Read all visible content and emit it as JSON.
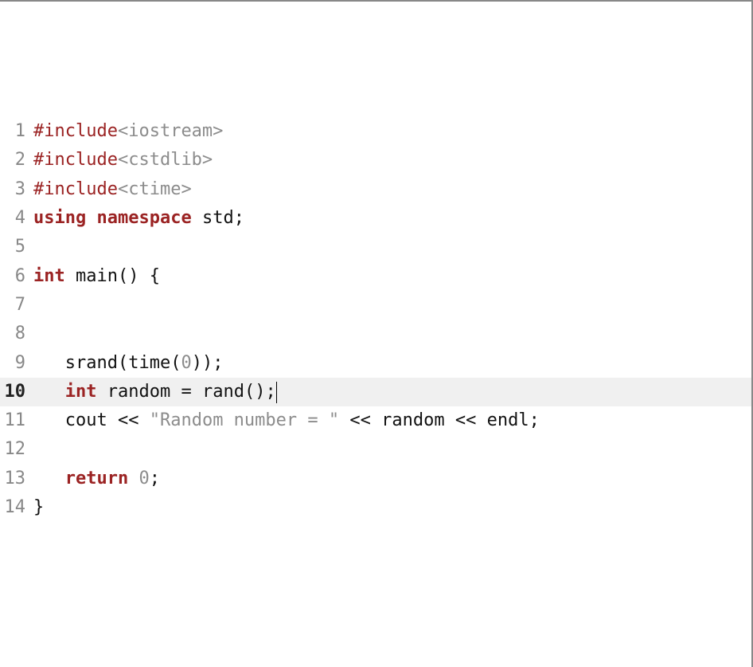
{
  "editor": {
    "highlighted_line": 10,
    "lines": [
      {
        "n": 1,
        "bold": false,
        "tokens": [
          {
            "cls": "preproc",
            "t": "#include"
          },
          {
            "cls": "anglebr",
            "t": "<iostream>"
          }
        ]
      },
      {
        "n": 2,
        "bold": false,
        "tokens": [
          {
            "cls": "preproc",
            "t": "#include"
          },
          {
            "cls": "anglebr",
            "t": "<cstdlib>"
          }
        ]
      },
      {
        "n": 3,
        "bold": false,
        "tokens": [
          {
            "cls": "preproc",
            "t": "#include"
          },
          {
            "cls": "anglebr",
            "t": "<ctime>"
          }
        ]
      },
      {
        "n": 4,
        "bold": false,
        "tokens": [
          {
            "cls": "keyword",
            "t": "using"
          },
          {
            "cls": "ident",
            "t": " "
          },
          {
            "cls": "keyword",
            "t": "namespace"
          },
          {
            "cls": "ident",
            "t": " std"
          },
          {
            "cls": "punct",
            "t": ";"
          }
        ]
      },
      {
        "n": 5,
        "bold": false,
        "tokens": []
      },
      {
        "n": 6,
        "bold": false,
        "tokens": [
          {
            "cls": "type",
            "t": "int"
          },
          {
            "cls": "ident",
            "t": " main"
          },
          {
            "cls": "punct",
            "t": "() {"
          }
        ]
      },
      {
        "n": 7,
        "bold": false,
        "tokens": []
      },
      {
        "n": 8,
        "bold": false,
        "tokens": []
      },
      {
        "n": 9,
        "bold": false,
        "tokens": [
          {
            "cls": "ident",
            "t": "   srand"
          },
          {
            "cls": "punct",
            "t": "("
          },
          {
            "cls": "ident",
            "t": "time"
          },
          {
            "cls": "punct",
            "t": "("
          },
          {
            "cls": "number",
            "t": "0"
          },
          {
            "cls": "punct",
            "t": "));"
          }
        ]
      },
      {
        "n": 10,
        "bold": true,
        "tokens": [
          {
            "cls": "ident",
            "t": "   "
          },
          {
            "cls": "type",
            "t": "int"
          },
          {
            "cls": "ident",
            "t": " random "
          },
          {
            "cls": "punct",
            "t": "="
          },
          {
            "cls": "ident",
            "t": " rand"
          },
          {
            "cls": "punct",
            "t": "();"
          }
        ],
        "cursor_after": true
      },
      {
        "n": 11,
        "bold": false,
        "tokens": [
          {
            "cls": "ident",
            "t": "   cout "
          },
          {
            "cls": "punct",
            "t": "<<"
          },
          {
            "cls": "ident",
            "t": " "
          },
          {
            "cls": "string",
            "t": "\"Random number = \""
          },
          {
            "cls": "ident",
            "t": " "
          },
          {
            "cls": "punct",
            "t": "<<"
          },
          {
            "cls": "ident",
            "t": " random "
          },
          {
            "cls": "punct",
            "t": "<<"
          },
          {
            "cls": "ident",
            "t": " endl"
          },
          {
            "cls": "punct",
            "t": ";"
          }
        ]
      },
      {
        "n": 12,
        "bold": false,
        "tokens": []
      },
      {
        "n": 13,
        "bold": false,
        "tokens": [
          {
            "cls": "ident",
            "t": "   "
          },
          {
            "cls": "keyword",
            "t": "return"
          },
          {
            "cls": "ident",
            "t": " "
          },
          {
            "cls": "number",
            "t": "0"
          },
          {
            "cls": "punct",
            "t": ";"
          }
        ]
      },
      {
        "n": 14,
        "bold": false,
        "tokens": [
          {
            "cls": "punct",
            "t": "}"
          }
        ]
      }
    ]
  }
}
